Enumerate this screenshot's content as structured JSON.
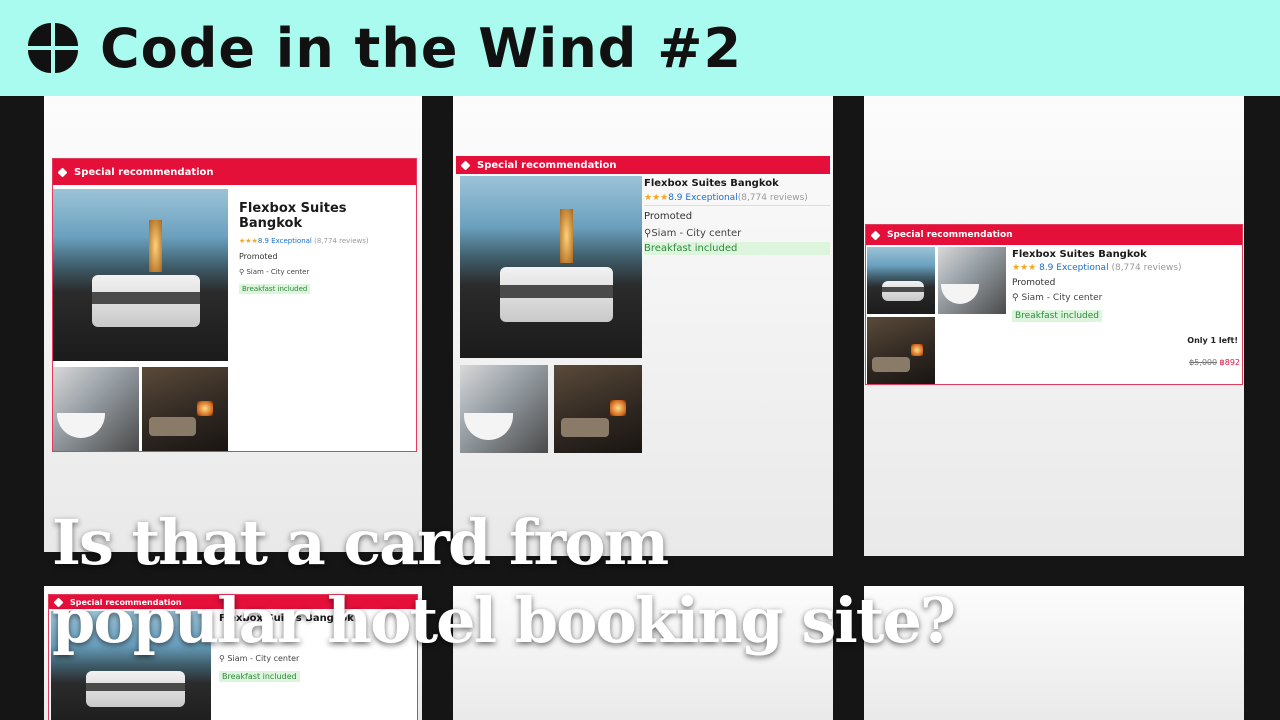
{
  "header": {
    "title": "Code in the Wind #2"
  },
  "card": {
    "banner": "Special recommendation",
    "hotel_name": "Flexbox Suites Bangkok",
    "stars": "★★★",
    "rating": "8.9 Exceptional",
    "reviews": "(8,774 reviews)",
    "promoted": "Promoted",
    "location": "Siam - City center",
    "breakfast": "Breakfast included",
    "only_left": "Only 1 left!",
    "old_price": "฿5,000",
    "new_price": "฿892"
  },
  "caption": {
    "line1": "Is that a card from",
    "line2": "popular hotel booking site?"
  },
  "colors": {
    "header_bg": "#a8fbee",
    "banner_red": "#e5103a",
    "rating_blue": "#1a6fc9",
    "breakfast_green": "#2e8b3b"
  },
  "icons": {
    "logo": "four-quadrant-logo-icon",
    "banner": "tag-icon",
    "location": "pin-icon"
  }
}
